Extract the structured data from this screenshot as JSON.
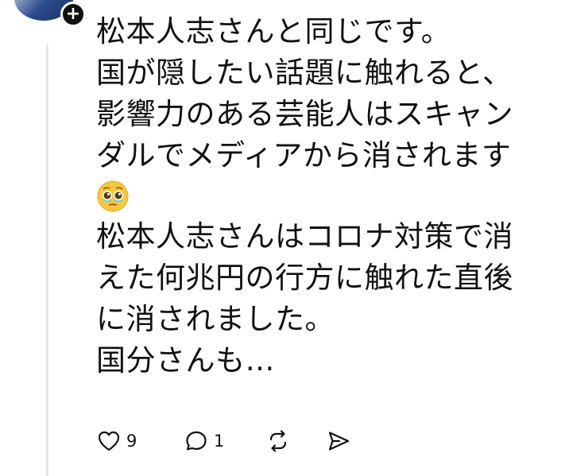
{
  "post": {
    "lines": [
      "松本人志さんと同じです。",
      "国が隠したい話題に触れると、",
      "影響力のある芸能人はスキャン",
      "ダルでメディアから消されます",
      "松本人志さんはコロナ対策で消",
      "えた何兆円の行方に触れた直後",
      "に消されました。",
      "国分さんも…"
    ],
    "emoji": "pleading-face-emoji"
  },
  "actions": {
    "likes": "9",
    "replies": "1"
  },
  "icons": {
    "like": "heart-icon",
    "reply": "comment-bubble-icon",
    "repost": "repost-icon",
    "share": "send-icon",
    "follow": "plus-icon"
  },
  "colors": {
    "text": "#111111",
    "thread_line": "#e6e6e6",
    "background": "#ffffff"
  }
}
